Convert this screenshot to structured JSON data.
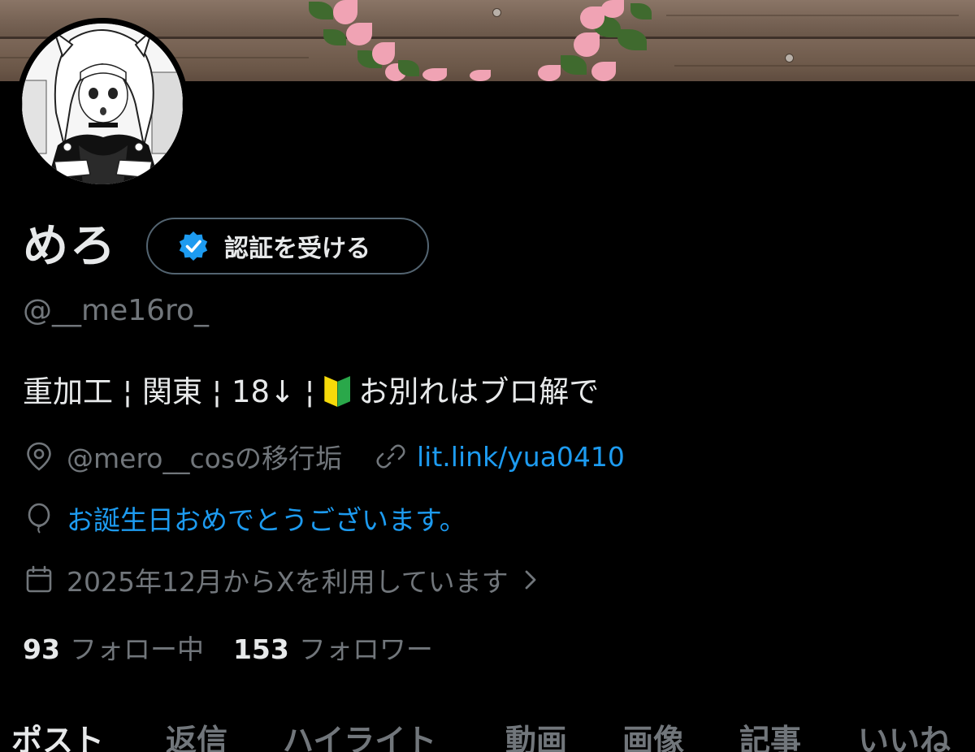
{
  "profile": {
    "display_name": "めろ",
    "verify_button_label": "認証を受ける",
    "handle": "@__me16ro_",
    "bio": {
      "part1": "重加工 ¦ 関東 ¦ 18↓ ¦ ",
      "part2": "お別れはブロ解で"
    },
    "location": "@mero__cosの移行垢",
    "website": "lit.link/yua0410",
    "birthday": "お誕生日おめでとうございます。",
    "joined": "2025年12月からXを利用しています"
  },
  "stats": {
    "following_count": "93",
    "following_label": "フォロー中",
    "followers_count": "153",
    "followers_label": "フォロワー"
  },
  "tabs": [
    {
      "label": "ポスト",
      "active": true
    },
    {
      "label": "返信",
      "active": false
    },
    {
      "label": "ハイライト",
      "active": false
    },
    {
      "label": "動画",
      "active": false
    },
    {
      "label": "画像",
      "active": false
    },
    {
      "label": "記事",
      "active": false
    },
    {
      "label": "いいね",
      "active": false
    }
  ],
  "icons": {
    "verify": "verified-badge-icon",
    "location": "location-pin-icon",
    "link": "link-icon",
    "birthday": "balloon-icon",
    "joined": "calendar-icon",
    "chevron": "chevron-right-icon",
    "bio_emoji": "beginner-mark-icon"
  },
  "colors": {
    "background": "#000000",
    "primary_text": "#e7e9ea",
    "secondary_text": "#71767b",
    "link": "#1d9bf0",
    "verify_blue": "#1d9bf0"
  }
}
